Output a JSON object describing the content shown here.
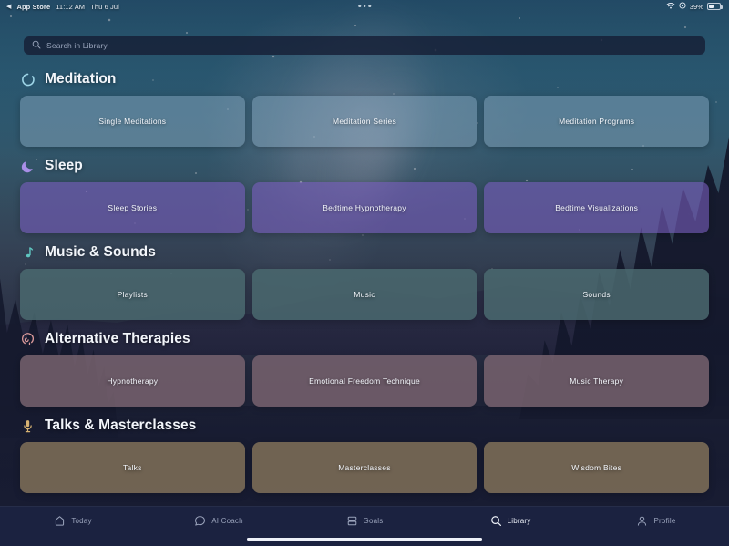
{
  "status_bar": {
    "back_arrow": "◀",
    "app_name": "App Store",
    "time": "11:12 AM",
    "date": "Thu 6 Jul",
    "wifi_icon": "wifi-icon",
    "control_icon": "control-center-icon",
    "battery_percent": "39%",
    "battery_icon": "battery-icon"
  },
  "search": {
    "placeholder": "Search in Library",
    "value": "",
    "icon": "search-icon"
  },
  "sections": [
    {
      "id": "meditation",
      "title": "Meditation",
      "icon": "meditation-circle-icon",
      "icon_color": "#9fd6e8",
      "cards": [
        "Single Meditations",
        "Meditation Series",
        "Meditation Programs"
      ]
    },
    {
      "id": "sleep",
      "title": "Sleep",
      "icon": "crescent-moon-icon",
      "icon_color": "#a98fe8",
      "cards": [
        "Sleep Stories",
        "Bedtime Hypnotherapy",
        "Bedtime Visualizations"
      ]
    },
    {
      "id": "music",
      "title": "Music & Sounds",
      "icon": "music-note-icon",
      "icon_color": "#5fc6c0",
      "cards": [
        "Playlists",
        "Music",
        "Sounds"
      ]
    },
    {
      "id": "therapy",
      "title": "Alternative Therapies",
      "icon": "head-profile-icon",
      "icon_color": "#dc9a9a",
      "cards": [
        "Hypnotherapy",
        "Emotional Freedom Technique",
        "Music Therapy"
      ]
    },
    {
      "id": "talks",
      "title": "Talks & Masterclasses",
      "icon": "microphone-icon",
      "icon_color": "#d6b272",
      "cards": [
        "Talks",
        "Masterclasses",
        "Wisdom Bites"
      ]
    }
  ],
  "tab_bar": {
    "active": "Library",
    "tabs": [
      {
        "label": "Today",
        "icon": "home-icon"
      },
      {
        "label": "AI Coach",
        "icon": "chat-bubble-icon"
      },
      {
        "label": "Goals",
        "icon": "stacked-bars-icon"
      },
      {
        "label": "Library",
        "icon": "search-icon"
      },
      {
        "label": "Profile",
        "icon": "person-icon"
      }
    ]
  },
  "colors": {
    "tab_bar_bg": "#1b2240",
    "active_tab": "#eef2f9",
    "inactive_tab": "#9aa3bb"
  }
}
